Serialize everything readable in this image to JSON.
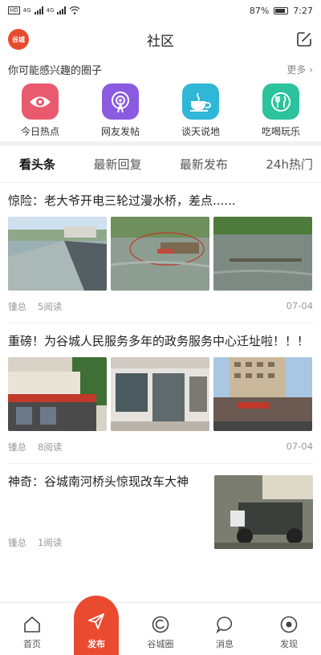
{
  "status": {
    "left_icons": [
      "hd-signal-icon",
      "hd-signal-icon",
      "wifi-icon"
    ],
    "sig_a": "4G",
    "sig_b": "4G",
    "battery": "87%",
    "time": "7:27"
  },
  "header": {
    "logo": "谷城",
    "title": "社区"
  },
  "interest": {
    "title": "你可能感兴趣的圈子",
    "more": "更多",
    "items": [
      {
        "label": "今日热点",
        "icon": "eye-icon",
        "color": "#ea5a6e"
      },
      {
        "label": "网友发帖",
        "icon": "broadcast-icon",
        "color": "#8a5be0"
      },
      {
        "label": "谈天说地",
        "icon": "coffee-icon",
        "color": "#2fb7d8"
      },
      {
        "label": "吃喝玩乐",
        "icon": "dining-icon",
        "color": "#2cc39c"
      }
    ]
  },
  "tabs": [
    "看头条",
    "最新回复",
    "最新发布",
    "24h热门"
  ],
  "posts": [
    {
      "title": "惊险：老大爷开电三轮过漫水桥，差点......",
      "author": "锺总",
      "reads": "5阅读",
      "date": "07-04"
    },
    {
      "title": "重磅！为谷城人民服务多年的政务服务中心迁址啦！！！",
      "author": "锺总",
      "reads": "8阅读",
      "date": "07-04"
    },
    {
      "title": "神奇：谷城南河桥头惊现改车大神",
      "author": "锺总",
      "reads": "1阅读"
    }
  ],
  "nav": [
    "首页",
    "发布",
    "谷城圈",
    "消息",
    "发现"
  ]
}
